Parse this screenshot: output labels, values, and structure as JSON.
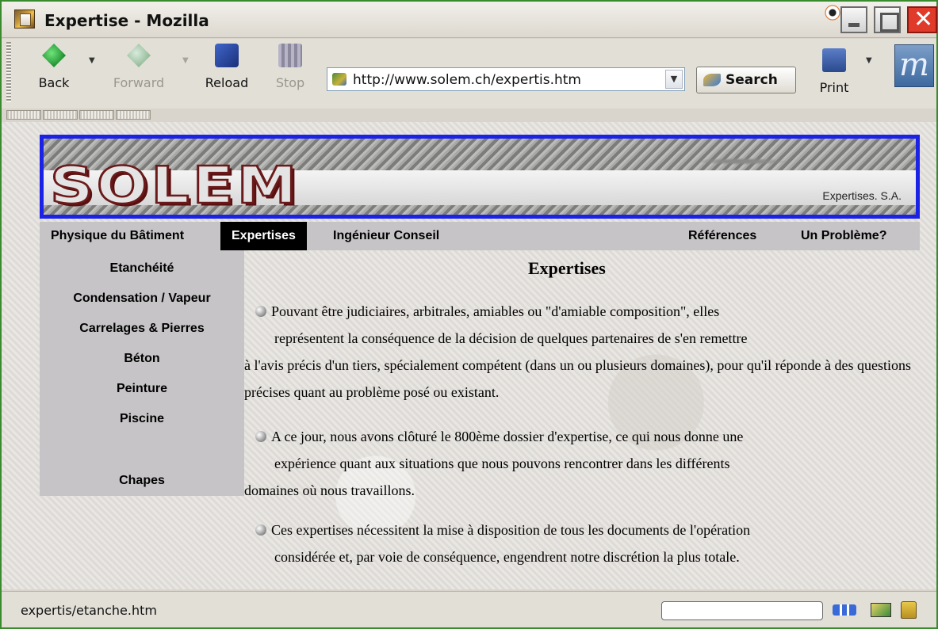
{
  "window": {
    "title": "Expertise - Mozilla",
    "close_glyph": "✕"
  },
  "toolbar": {
    "back_label": "Back",
    "forward_label": "Forward",
    "reload_label": "Reload",
    "stop_label": "Stop",
    "url": "http://www.solem.ch/expertis.htm",
    "search_label": "Search",
    "print_label": "Print",
    "logo_letter": "m",
    "dropdown_glyph": "▼"
  },
  "page": {
    "banner_tagline": "Expertises. S.A.",
    "logo_text": "SOLEM",
    "nav": [
      {
        "label": "Physique du Bâtiment",
        "active": false
      },
      {
        "label": "Expertises",
        "active": true
      },
      {
        "label": "Ingénieur Conseil",
        "active": false
      },
      {
        "label": "Références",
        "active": false
      },
      {
        "label": "Un Problème?",
        "active": false
      }
    ],
    "submenu": [
      "Etanchéité",
      "Condensation / Vapeur",
      "Carrelages & Pierres",
      "Béton",
      "Peinture",
      "Piscine",
      "Chapes"
    ],
    "title": "Expertises",
    "paragraphs": [
      {
        "line1": "Pouvant être judiciaires, arbitrales, amiables ou \"d'amiable composition\", elles",
        "line2": "représentent la conséquence de la décision de quelques partenaires de s'en remettre",
        "rest": "à l'avis précis d'un tiers, spécialement compétent (dans un ou plusieurs domaines), pour qu'il réponde à des questions précises quant au problème posé ou existant."
      },
      {
        "line1": "A ce jour, nous avons clôturé le 800ème dossier d'expertise, ce qui nous donne une",
        "line2": "expérience quant aux situations que nous pouvons rencontrer dans les différents",
        "rest": "domaines où nous travaillons."
      },
      {
        "line1": "Ces expertises nécessitent la mise à disposition de tous les documents de l'opération",
        "line2": "considérée et, par voie de conséquence, engendrent notre discrétion la plus totale.",
        "rest": ""
      }
    ]
  },
  "statusbar": {
    "text": "expertis/etanche.htm"
  },
  "colors": {
    "banner_border": "#1a22e8",
    "nav_bg": "#c6c4c6",
    "nav_active_bg": "#000000",
    "window_border": "#3a8a2e"
  }
}
